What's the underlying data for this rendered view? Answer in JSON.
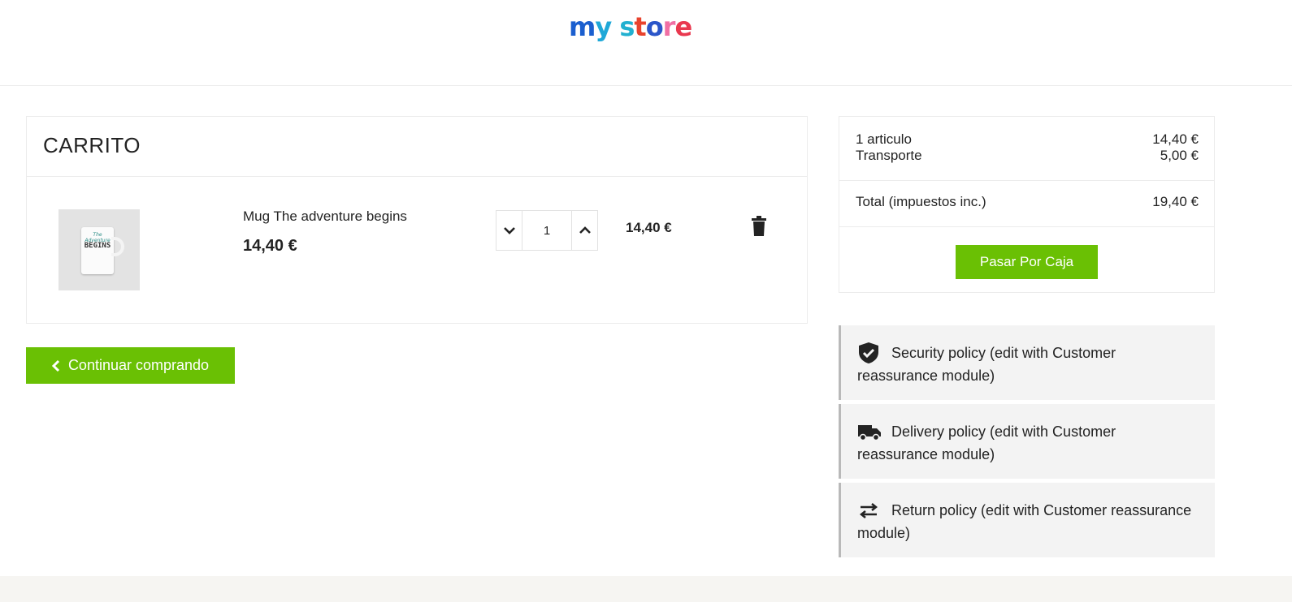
{
  "header": {
    "logo": {
      "part1": "my",
      "part2": "store"
    }
  },
  "cart": {
    "title": "CARRITO",
    "item": {
      "name": "Mug The adventure begins",
      "price": "14,40 €",
      "quantity": "1",
      "line_total": "14,40 €",
      "image_text": {
        "script": "The Adventure",
        "main": "BEGINS"
      }
    },
    "continue_label": "Continuar comprando"
  },
  "summary": {
    "items_label": "1 articulo",
    "items_value": "14,40 €",
    "shipping_label": "Transporte",
    "shipping_value": "5,00 €",
    "total_label": "Total (impuestos inc.)",
    "total_value": "19,40 €",
    "checkout_label": "Pasar Por Caja"
  },
  "reassurance": [
    {
      "icon": "shield-check-icon",
      "text": "Security policy (edit with Customer reassurance module)"
    },
    {
      "icon": "truck-icon",
      "text": "Delivery policy (edit with Customer reassurance module)"
    },
    {
      "icon": "swap-arrows-icon",
      "text": "Return policy (edit with Customer reassurance module)"
    }
  ],
  "colors": {
    "accent": "#6ac004",
    "panel": "#f3f3f3",
    "text": "#232323"
  }
}
